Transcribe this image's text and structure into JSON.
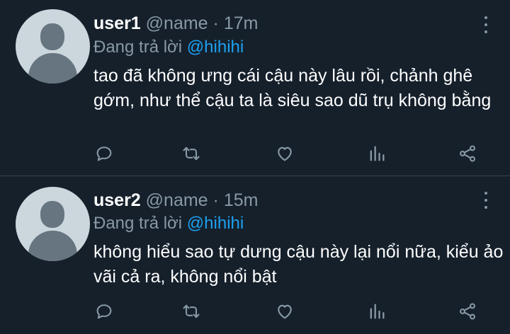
{
  "tweets": [
    {
      "username": "user1",
      "handle": "@name",
      "separator": "·",
      "time": "17m",
      "reply_prefix": "Đang trả lời",
      "reply_to": "@hihihi",
      "text": "tao đã không ưng cái cậu này lâu rồi, chảnh ghê gớm, như thể cậu ta là siêu sao dũ trụ không bằng",
      "icons": [
        "reply-icon",
        "retweet-icon",
        "like-icon",
        "views-icon",
        "share-icon"
      ]
    },
    {
      "username": "user2",
      "handle": "@name",
      "separator": "·",
      "time": "15m",
      "reply_prefix": "Đang trả lời",
      "reply_to": "@hihihi",
      "text": "không hiểu sao tự dưng cậu này lại nổi nữa, kiểu ảo vãi cả ra, không nổi bật",
      "icons": [
        "reply-icon",
        "retweet-icon",
        "like-icon",
        "views-icon",
        "share-icon"
      ]
    }
  ],
  "colors": {
    "background": "#15202b",
    "text": "#ffffff",
    "muted": "#8899a6",
    "link": "#1da1f2",
    "divider": "#38444d",
    "avatar_bg": "#ccd6dd",
    "avatar_fg": "#66757f"
  }
}
